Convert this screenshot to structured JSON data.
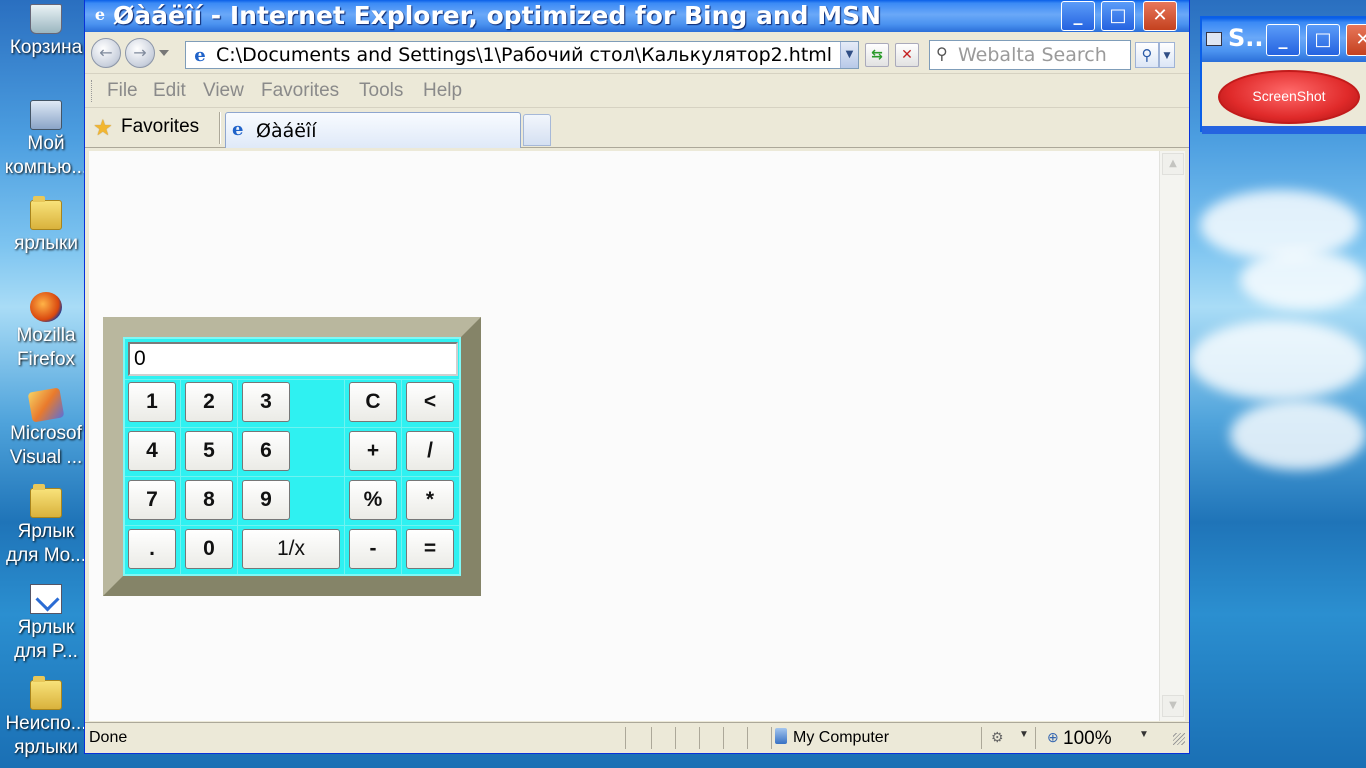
{
  "desktop": {
    "icons": [
      {
        "label": "Корзина",
        "icon": "recycle-bin-icon"
      },
      {
        "label": "Мой компью...",
        "icon": "my-computer-icon"
      },
      {
        "label": "ярлыки",
        "icon": "folder-icon"
      },
      {
        "label": "Mozilla Firefox",
        "icon": "firefox-icon"
      },
      {
        "label": "Microsof Visual ...",
        "icon": "visual-studio-icon"
      },
      {
        "label": "Ярлык для Mo...",
        "icon": "folder-shortcut-icon"
      },
      {
        "label": "Ярлык для P...",
        "icon": "document-shortcut-icon"
      },
      {
        "label": "Неиспо... ярлыки",
        "icon": "folder-icon"
      }
    ]
  },
  "ie": {
    "title": "Øàáëîí - Internet Explorer, optimized for Bing and MSN",
    "address": "C:\\Documents and Settings\\1\\Рабочий стол\\Калькулятор2.html",
    "search_placeholder": "Webalta Search",
    "menu": [
      "File",
      "Edit",
      "View",
      "Favorites",
      "Tools",
      "Help"
    ],
    "favorites_label": "Favorites",
    "tab_title": "Øàáëîí",
    "status": {
      "text": "Done",
      "zone": "My Computer",
      "zoom": "100%"
    }
  },
  "calculator": {
    "display": "0",
    "rows": [
      [
        "1",
        "2",
        "3",
        "",
        "C",
        "<"
      ],
      [
        "4",
        "5",
        "6",
        "",
        "+",
        "/"
      ],
      [
        "7",
        "8",
        "9",
        "",
        "%",
        "*"
      ],
      [
        ".",
        "0",
        "1/x",
        "",
        "-",
        "="
      ]
    ]
  },
  "screenshot_app": {
    "title": "S..",
    "button_label": "ScreenShot"
  },
  "colors": {
    "calc_bg": "#2ff1f1",
    "calc_frame_light": "#b9b79e",
    "calc_frame_dark": "#858468",
    "xp_blue": "#0a5fe8",
    "screenshot_red": "#e02a2a"
  }
}
